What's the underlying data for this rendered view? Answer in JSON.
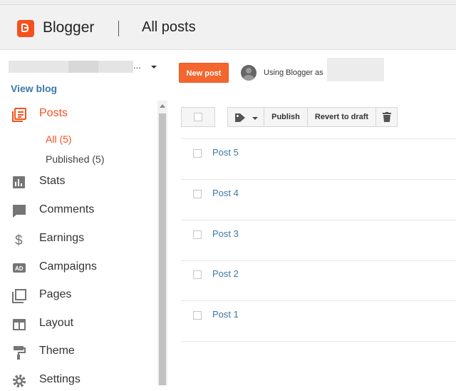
{
  "header": {
    "app_name": "Blogger",
    "page_title": "All posts"
  },
  "sidebar": {
    "blog_ellipsis": "...",
    "view_blog": "View blog",
    "items": [
      {
        "label": "Posts",
        "icon": "posts-icon"
      },
      {
        "label": "Stats",
        "icon": "stats-icon"
      },
      {
        "label": "Comments",
        "icon": "comments-icon"
      },
      {
        "label": "Earnings",
        "icon": "dollar-icon"
      },
      {
        "label": "Campaigns",
        "icon": "ad-icon"
      },
      {
        "label": "Pages",
        "icon": "pages-icon"
      },
      {
        "label": "Layout",
        "icon": "layout-icon"
      },
      {
        "label": "Theme",
        "icon": "paint-roller-icon"
      },
      {
        "label": "Settings",
        "icon": "gear-icon"
      }
    ],
    "sub_items": [
      {
        "label": "All (5)"
      },
      {
        "label": "Published (5)"
      }
    ]
  },
  "actions": {
    "new_post": "New post",
    "using_as": "Using Blogger as"
  },
  "toolbar": {
    "publish": "Publish",
    "revert": "Revert to draft"
  },
  "posts": [
    {
      "title": "Post 5"
    },
    {
      "title": "Post 4"
    },
    {
      "title": "Post 3"
    },
    {
      "title": "Post 2"
    },
    {
      "title": "Post 1"
    }
  ],
  "colors": {
    "accent": "#f4511e",
    "link": "#3b78a8",
    "icon_gray": "#757575"
  }
}
